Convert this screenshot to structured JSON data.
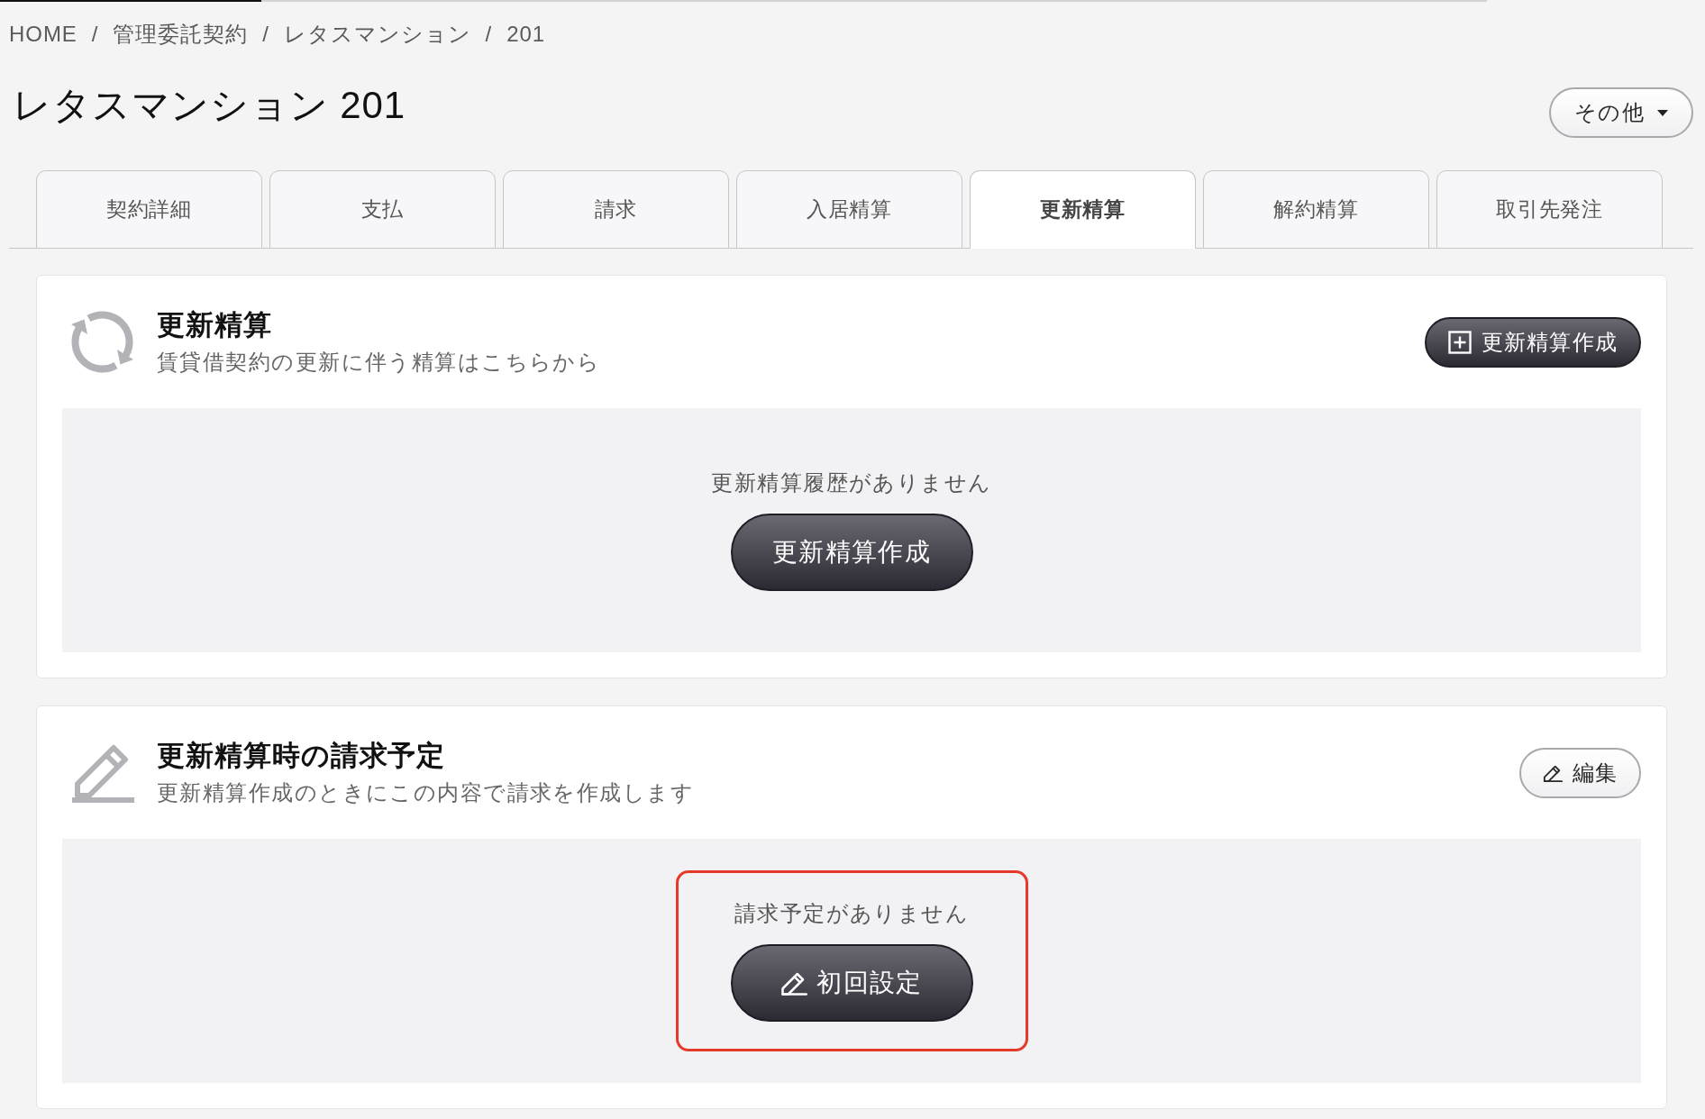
{
  "breadcrumb": {
    "items": [
      "HOME",
      "管理委託契約",
      "レタスマンション",
      "201"
    ],
    "separators": [
      "/",
      "/",
      "/"
    ]
  },
  "page_title": "レタスマンション 201",
  "more_button": {
    "label": "その他"
  },
  "tabs": [
    {
      "label": "契約詳細",
      "selected": false
    },
    {
      "label": "支払",
      "selected": false
    },
    {
      "label": "請求",
      "selected": false
    },
    {
      "label": "入居精算",
      "selected": false
    },
    {
      "label": "更新精算",
      "selected": true
    },
    {
      "label": "解約精算",
      "selected": false
    },
    {
      "label": "取引先発注",
      "selected": false
    }
  ],
  "sections": [
    {
      "kind": "renewal",
      "title": "更新精算",
      "subtitle": "賃貸借契約の更新に伴う精算はこちらから",
      "action": {
        "kind": "add",
        "label": "更新精算作成"
      },
      "empty": {
        "message": "更新精算履歴がありません",
        "highlighted": false,
        "button": {
          "kind": "plain",
          "label": "更新精算作成"
        }
      }
    },
    {
      "kind": "schedule",
      "title": "更新精算時の請求予定",
      "subtitle": "更新精算作成のときにこの内容で請求を作成します",
      "action": {
        "kind": "edit",
        "label": "編集"
      },
      "empty": {
        "message": "請求予定がありません",
        "highlighted": true,
        "button": {
          "kind": "setup",
          "label": "初回設定"
        }
      }
    }
  ]
}
